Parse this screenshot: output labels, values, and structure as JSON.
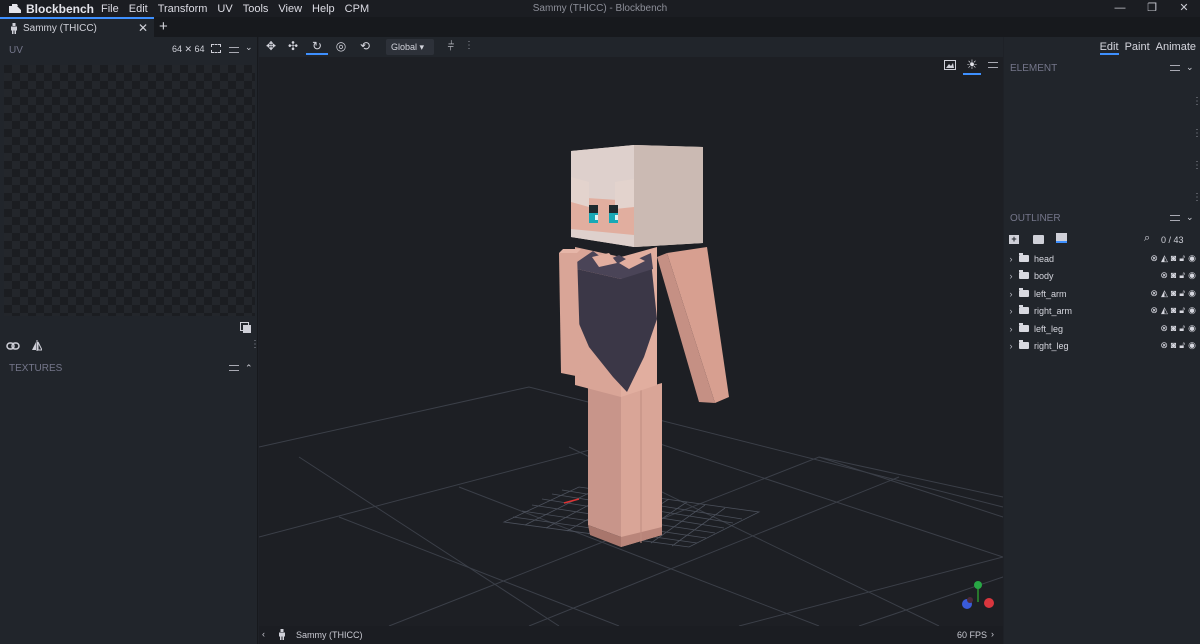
{
  "app": {
    "name": "Blockbench",
    "window_title": "Sammy (THICC) - Blockbench"
  },
  "menu": [
    "File",
    "Edit",
    "Transform",
    "UV",
    "Tools",
    "View",
    "Help",
    "CPM"
  ],
  "window_controls": {
    "minimize": "—",
    "maximize": "❐",
    "close": "✕"
  },
  "tabs": [
    {
      "label": "Sammy (THICC)",
      "close": "✕"
    }
  ],
  "new_tab": "+",
  "left_panel": {
    "uv_title": "UV",
    "uv_size": "64 ✕ 64",
    "textures_title": "TEXTURES"
  },
  "toolbar": {
    "space_label": "Global"
  },
  "viewport": {
    "model_name": "Sammy (THICC)",
    "fps": "60 FPS"
  },
  "right_panel": {
    "modes": [
      "Edit",
      "Paint",
      "Animate"
    ],
    "element_title": "ELEMENT",
    "outliner_title": "OUTLINER",
    "outliner_count": "0 / 43",
    "outliner_items": [
      {
        "name": "head"
      },
      {
        "name": "body"
      },
      {
        "name": "left_arm"
      },
      {
        "name": "right_arm"
      },
      {
        "name": "left_leg"
      },
      {
        "name": "right_leg"
      }
    ]
  },
  "colors": {
    "accent": "#3e90ff",
    "background": "#1e2127",
    "panel": "#21252b"
  },
  "icons": [
    "blockbench-logo-icon",
    "person-icon",
    "fullscreen-icon",
    "hamburger-icon",
    "copy-icon",
    "link-icon",
    "mirror-icon",
    "pivot-tool-icon",
    "move-tool-icon",
    "rotate-tool-icon",
    "vertex-snap-icon",
    "resize-tool-icon",
    "image-icon",
    "sun-icon",
    "add-cube-icon",
    "add-group-icon",
    "search-icon",
    "folder-icon",
    "eye-icon",
    "lock-icon",
    "camera-icon"
  ]
}
